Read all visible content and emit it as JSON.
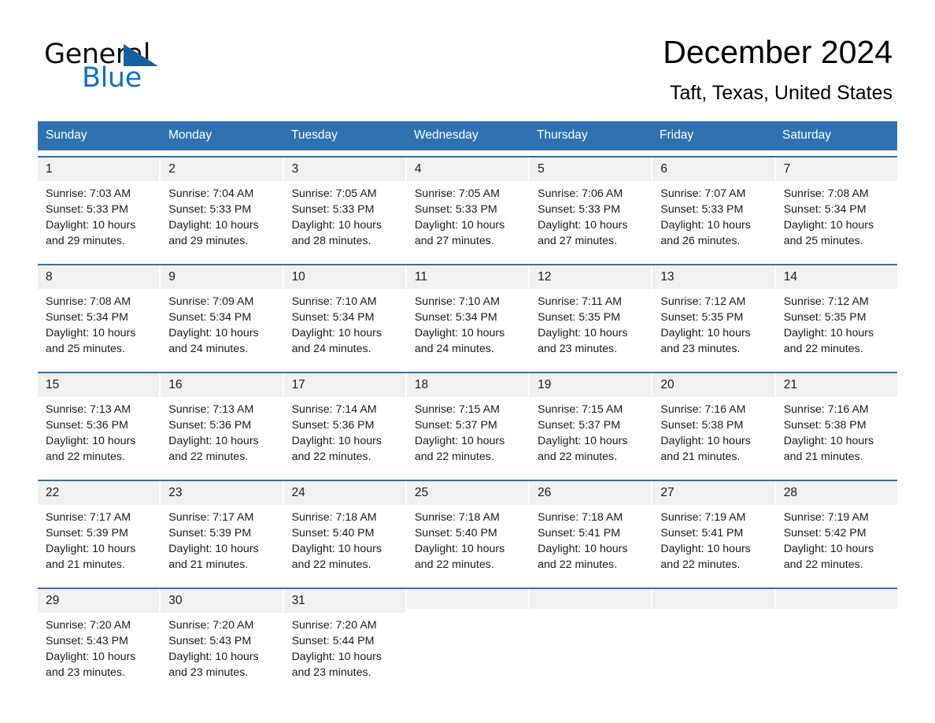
{
  "brand": {
    "name_top": "General",
    "name_bottom": "Blue",
    "accent_color": "#15619f",
    "blue_text_color": "#0f72c0"
  },
  "header": {
    "title": "December 2024",
    "subtitle": "Taft, Texas, United States"
  },
  "calendar": {
    "header_bg": "#3071b0",
    "day_band_bg": "#f1f1f1",
    "weekdays": [
      "Sunday",
      "Monday",
      "Tuesday",
      "Wednesday",
      "Thursday",
      "Friday",
      "Saturday"
    ],
    "weeks": [
      [
        {
          "day": "1",
          "sunrise": "Sunrise: 7:03 AM",
          "sunset": "Sunset: 5:33 PM",
          "daylight_line1": "Daylight: 10 hours",
          "daylight_line2": "and 29 minutes."
        },
        {
          "day": "2",
          "sunrise": "Sunrise: 7:04 AM",
          "sunset": "Sunset: 5:33 PM",
          "daylight_line1": "Daylight: 10 hours",
          "daylight_line2": "and 29 minutes."
        },
        {
          "day": "3",
          "sunrise": "Sunrise: 7:05 AM",
          "sunset": "Sunset: 5:33 PM",
          "daylight_line1": "Daylight: 10 hours",
          "daylight_line2": "and 28 minutes."
        },
        {
          "day": "4",
          "sunrise": "Sunrise: 7:05 AM",
          "sunset": "Sunset: 5:33 PM",
          "daylight_line1": "Daylight: 10 hours",
          "daylight_line2": "and 27 minutes."
        },
        {
          "day": "5",
          "sunrise": "Sunrise: 7:06 AM",
          "sunset": "Sunset: 5:33 PM",
          "daylight_line1": "Daylight: 10 hours",
          "daylight_line2": "and 27 minutes."
        },
        {
          "day": "6",
          "sunrise": "Sunrise: 7:07 AM",
          "sunset": "Sunset: 5:33 PM",
          "daylight_line1": "Daylight: 10 hours",
          "daylight_line2": "and 26 minutes."
        },
        {
          "day": "7",
          "sunrise": "Sunrise: 7:08 AM",
          "sunset": "Sunset: 5:34 PM",
          "daylight_line1": "Daylight: 10 hours",
          "daylight_line2": "and 25 minutes."
        }
      ],
      [
        {
          "day": "8",
          "sunrise": "Sunrise: 7:08 AM",
          "sunset": "Sunset: 5:34 PM",
          "daylight_line1": "Daylight: 10 hours",
          "daylight_line2": "and 25 minutes."
        },
        {
          "day": "9",
          "sunrise": "Sunrise: 7:09 AM",
          "sunset": "Sunset: 5:34 PM",
          "daylight_line1": "Daylight: 10 hours",
          "daylight_line2": "and 24 minutes."
        },
        {
          "day": "10",
          "sunrise": "Sunrise: 7:10 AM",
          "sunset": "Sunset: 5:34 PM",
          "daylight_line1": "Daylight: 10 hours",
          "daylight_line2": "and 24 minutes."
        },
        {
          "day": "11",
          "sunrise": "Sunrise: 7:10 AM",
          "sunset": "Sunset: 5:34 PM",
          "daylight_line1": "Daylight: 10 hours",
          "daylight_line2": "and 24 minutes."
        },
        {
          "day": "12",
          "sunrise": "Sunrise: 7:11 AM",
          "sunset": "Sunset: 5:35 PM",
          "daylight_line1": "Daylight: 10 hours",
          "daylight_line2": "and 23 minutes."
        },
        {
          "day": "13",
          "sunrise": "Sunrise: 7:12 AM",
          "sunset": "Sunset: 5:35 PM",
          "daylight_line1": "Daylight: 10 hours",
          "daylight_line2": "and 23 minutes."
        },
        {
          "day": "14",
          "sunrise": "Sunrise: 7:12 AM",
          "sunset": "Sunset: 5:35 PM",
          "daylight_line1": "Daylight: 10 hours",
          "daylight_line2": "and 22 minutes."
        }
      ],
      [
        {
          "day": "15",
          "sunrise": "Sunrise: 7:13 AM",
          "sunset": "Sunset: 5:36 PM",
          "daylight_line1": "Daylight: 10 hours",
          "daylight_line2": "and 22 minutes."
        },
        {
          "day": "16",
          "sunrise": "Sunrise: 7:13 AM",
          "sunset": "Sunset: 5:36 PM",
          "daylight_line1": "Daylight: 10 hours",
          "daylight_line2": "and 22 minutes."
        },
        {
          "day": "17",
          "sunrise": "Sunrise: 7:14 AM",
          "sunset": "Sunset: 5:36 PM",
          "daylight_line1": "Daylight: 10 hours",
          "daylight_line2": "and 22 minutes."
        },
        {
          "day": "18",
          "sunrise": "Sunrise: 7:15 AM",
          "sunset": "Sunset: 5:37 PM",
          "daylight_line1": "Daylight: 10 hours",
          "daylight_line2": "and 22 minutes."
        },
        {
          "day": "19",
          "sunrise": "Sunrise: 7:15 AM",
          "sunset": "Sunset: 5:37 PM",
          "daylight_line1": "Daylight: 10 hours",
          "daylight_line2": "and 22 minutes."
        },
        {
          "day": "20",
          "sunrise": "Sunrise: 7:16 AM",
          "sunset": "Sunset: 5:38 PM",
          "daylight_line1": "Daylight: 10 hours",
          "daylight_line2": "and 21 minutes."
        },
        {
          "day": "21",
          "sunrise": "Sunrise: 7:16 AM",
          "sunset": "Sunset: 5:38 PM",
          "daylight_line1": "Daylight: 10 hours",
          "daylight_line2": "and 21 minutes."
        }
      ],
      [
        {
          "day": "22",
          "sunrise": "Sunrise: 7:17 AM",
          "sunset": "Sunset: 5:39 PM",
          "daylight_line1": "Daylight: 10 hours",
          "daylight_line2": "and 21 minutes."
        },
        {
          "day": "23",
          "sunrise": "Sunrise: 7:17 AM",
          "sunset": "Sunset: 5:39 PM",
          "daylight_line1": "Daylight: 10 hours",
          "daylight_line2": "and 21 minutes."
        },
        {
          "day": "24",
          "sunrise": "Sunrise: 7:18 AM",
          "sunset": "Sunset: 5:40 PM",
          "daylight_line1": "Daylight: 10 hours",
          "daylight_line2": "and 22 minutes."
        },
        {
          "day": "25",
          "sunrise": "Sunrise: 7:18 AM",
          "sunset": "Sunset: 5:40 PM",
          "daylight_line1": "Daylight: 10 hours",
          "daylight_line2": "and 22 minutes."
        },
        {
          "day": "26",
          "sunrise": "Sunrise: 7:18 AM",
          "sunset": "Sunset: 5:41 PM",
          "daylight_line1": "Daylight: 10 hours",
          "daylight_line2": "and 22 minutes."
        },
        {
          "day": "27",
          "sunrise": "Sunrise: 7:19 AM",
          "sunset": "Sunset: 5:41 PM",
          "daylight_line1": "Daylight: 10 hours",
          "daylight_line2": "and 22 minutes."
        },
        {
          "day": "28",
          "sunrise": "Sunrise: 7:19 AM",
          "sunset": "Sunset: 5:42 PM",
          "daylight_line1": "Daylight: 10 hours",
          "daylight_line2": "and 22 minutes."
        }
      ],
      [
        {
          "day": "29",
          "sunrise": "Sunrise: 7:20 AM",
          "sunset": "Sunset: 5:43 PM",
          "daylight_line1": "Daylight: 10 hours",
          "daylight_line2": "and 23 minutes."
        },
        {
          "day": "30",
          "sunrise": "Sunrise: 7:20 AM",
          "sunset": "Sunset: 5:43 PM",
          "daylight_line1": "Daylight: 10 hours",
          "daylight_line2": "and 23 minutes."
        },
        {
          "day": "31",
          "sunrise": "Sunrise: 7:20 AM",
          "sunset": "Sunset: 5:44 PM",
          "daylight_line1": "Daylight: 10 hours",
          "daylight_line2": "and 23 minutes."
        },
        {
          "day": "",
          "sunrise": "",
          "sunset": "",
          "daylight_line1": "",
          "daylight_line2": ""
        },
        {
          "day": "",
          "sunrise": "",
          "sunset": "",
          "daylight_line1": "",
          "daylight_line2": ""
        },
        {
          "day": "",
          "sunrise": "",
          "sunset": "",
          "daylight_line1": "",
          "daylight_line2": ""
        },
        {
          "day": "",
          "sunrise": "",
          "sunset": "",
          "daylight_line1": "",
          "daylight_line2": ""
        }
      ]
    ]
  }
}
